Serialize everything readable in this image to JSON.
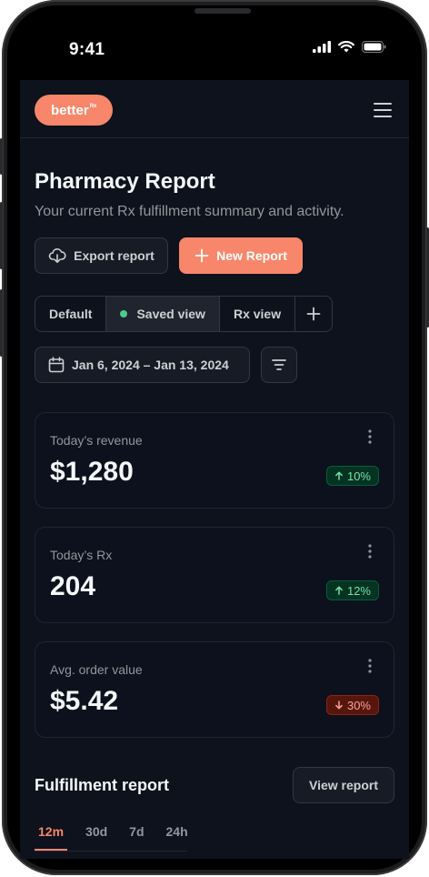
{
  "status_bar": {
    "time": "9:41"
  },
  "header": {
    "logo_text": "better",
    "logo_sup": "Rx"
  },
  "page": {
    "title": "Pharmacy Report",
    "subtitle": "Your current Rx fulfillment summary and activity."
  },
  "actions": {
    "export_label": "Export report",
    "new_label": "New Report"
  },
  "views": {
    "items": [
      "Default",
      "Saved view",
      "Rx view"
    ],
    "active": "Saved view"
  },
  "date_range": {
    "label": "Jan 6, 2024 – Jan 13, 2024"
  },
  "metrics": [
    {
      "label": "Today’s revenue",
      "value": "$1,280",
      "change": "10%",
      "direction": "up"
    },
    {
      "label": "Today’s Rx",
      "value": "204",
      "change": "12%",
      "direction": "up"
    },
    {
      "label": "Avg. order value",
      "value": "$5.42",
      "change": "30%",
      "direction": "down"
    }
  ],
  "fulfillment": {
    "title": "Fulfillment report",
    "view_label": "View report",
    "tabs": [
      "12m",
      "30d",
      "7d",
      "24h"
    ],
    "active_tab": "12m"
  },
  "colors": {
    "accent": "#f7866a",
    "background": "#0d121c",
    "positive": "#75e0a7",
    "negative": "#fda29b"
  }
}
